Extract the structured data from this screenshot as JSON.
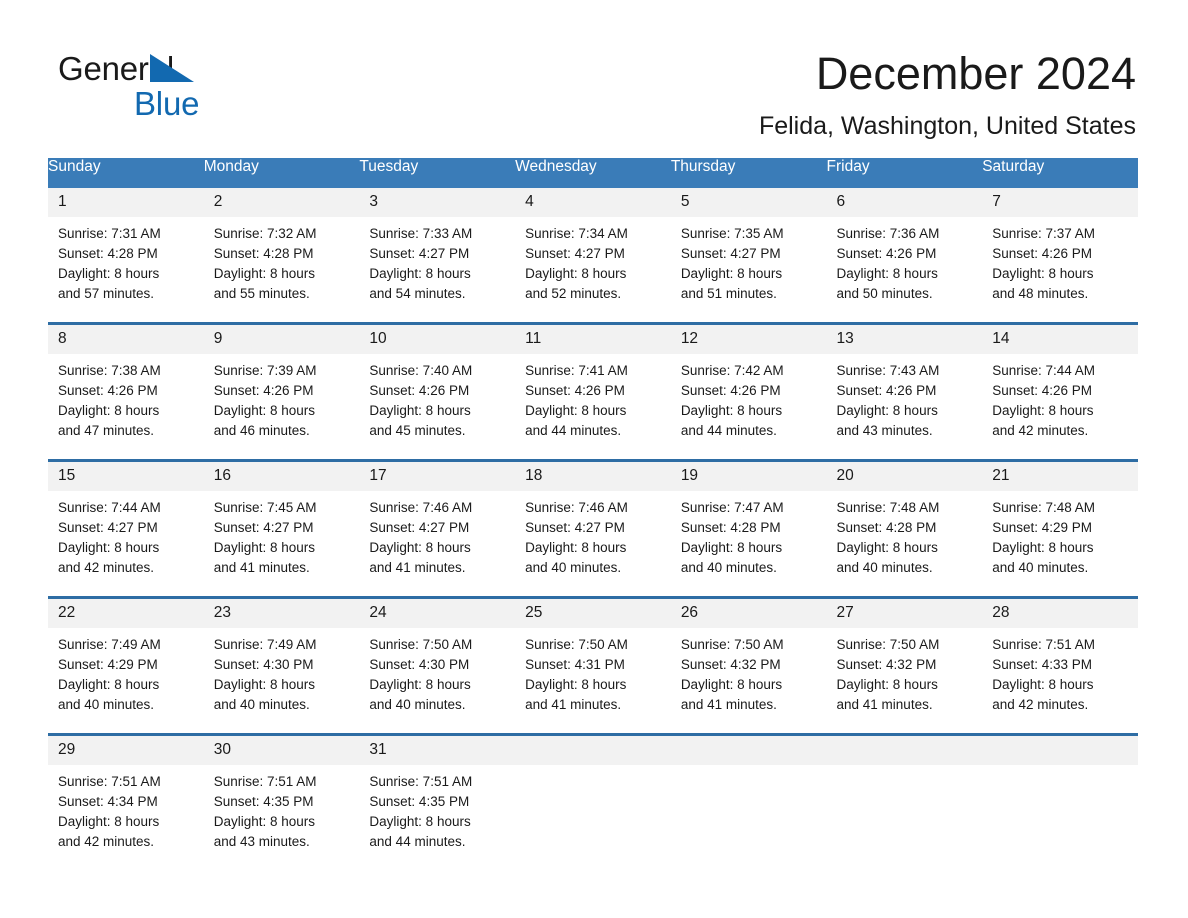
{
  "brand": {
    "name_line1": "General",
    "name_line2": "Blue",
    "accent_color": "#1269b0"
  },
  "header": {
    "month_title": "December 2024",
    "location": "Felida, Washington, United States"
  },
  "theme": {
    "header_blue": "#3a7cb8",
    "row_divider_blue": "#2e6da4",
    "daynum_band": "#f2f2f2",
    "text": "#1a1a1a"
  },
  "weekday_headers": [
    "Sunday",
    "Monday",
    "Tuesday",
    "Wednesday",
    "Thursday",
    "Friday",
    "Saturday"
  ],
  "weeks": [
    {
      "days": [
        {
          "day": "1",
          "sunrise": "Sunrise: 7:31 AM",
          "sunset": "Sunset: 4:28 PM",
          "daylight1": "Daylight: 8 hours",
          "daylight2": "and 57 minutes."
        },
        {
          "day": "2",
          "sunrise": "Sunrise: 7:32 AM",
          "sunset": "Sunset: 4:28 PM",
          "daylight1": "Daylight: 8 hours",
          "daylight2": "and 55 minutes."
        },
        {
          "day": "3",
          "sunrise": "Sunrise: 7:33 AM",
          "sunset": "Sunset: 4:27 PM",
          "daylight1": "Daylight: 8 hours",
          "daylight2": "and 54 minutes."
        },
        {
          "day": "4",
          "sunrise": "Sunrise: 7:34 AM",
          "sunset": "Sunset: 4:27 PM",
          "daylight1": "Daylight: 8 hours",
          "daylight2": "and 52 minutes."
        },
        {
          "day": "5",
          "sunrise": "Sunrise: 7:35 AM",
          "sunset": "Sunset: 4:27 PM",
          "daylight1": "Daylight: 8 hours",
          "daylight2": "and 51 minutes."
        },
        {
          "day": "6",
          "sunrise": "Sunrise: 7:36 AM",
          "sunset": "Sunset: 4:26 PM",
          "daylight1": "Daylight: 8 hours",
          "daylight2": "and 50 minutes."
        },
        {
          "day": "7",
          "sunrise": "Sunrise: 7:37 AM",
          "sunset": "Sunset: 4:26 PM",
          "daylight1": "Daylight: 8 hours",
          "daylight2": "and 48 minutes."
        }
      ]
    },
    {
      "days": [
        {
          "day": "8",
          "sunrise": "Sunrise: 7:38 AM",
          "sunset": "Sunset: 4:26 PM",
          "daylight1": "Daylight: 8 hours",
          "daylight2": "and 47 minutes."
        },
        {
          "day": "9",
          "sunrise": "Sunrise: 7:39 AM",
          "sunset": "Sunset: 4:26 PM",
          "daylight1": "Daylight: 8 hours",
          "daylight2": "and 46 minutes."
        },
        {
          "day": "10",
          "sunrise": "Sunrise: 7:40 AM",
          "sunset": "Sunset: 4:26 PM",
          "daylight1": "Daylight: 8 hours",
          "daylight2": "and 45 minutes."
        },
        {
          "day": "11",
          "sunrise": "Sunrise: 7:41 AM",
          "sunset": "Sunset: 4:26 PM",
          "daylight1": "Daylight: 8 hours",
          "daylight2": "and 44 minutes."
        },
        {
          "day": "12",
          "sunrise": "Sunrise: 7:42 AM",
          "sunset": "Sunset: 4:26 PM",
          "daylight1": "Daylight: 8 hours",
          "daylight2": "and 44 minutes."
        },
        {
          "day": "13",
          "sunrise": "Sunrise: 7:43 AM",
          "sunset": "Sunset: 4:26 PM",
          "daylight1": "Daylight: 8 hours",
          "daylight2": "and 43 minutes."
        },
        {
          "day": "14",
          "sunrise": "Sunrise: 7:44 AM",
          "sunset": "Sunset: 4:26 PM",
          "daylight1": "Daylight: 8 hours",
          "daylight2": "and 42 minutes."
        }
      ]
    },
    {
      "days": [
        {
          "day": "15",
          "sunrise": "Sunrise: 7:44 AM",
          "sunset": "Sunset: 4:27 PM",
          "daylight1": "Daylight: 8 hours",
          "daylight2": "and 42 minutes."
        },
        {
          "day": "16",
          "sunrise": "Sunrise: 7:45 AM",
          "sunset": "Sunset: 4:27 PM",
          "daylight1": "Daylight: 8 hours",
          "daylight2": "and 41 minutes."
        },
        {
          "day": "17",
          "sunrise": "Sunrise: 7:46 AM",
          "sunset": "Sunset: 4:27 PM",
          "daylight1": "Daylight: 8 hours",
          "daylight2": "and 41 minutes."
        },
        {
          "day": "18",
          "sunrise": "Sunrise: 7:46 AM",
          "sunset": "Sunset: 4:27 PM",
          "daylight1": "Daylight: 8 hours",
          "daylight2": "and 40 minutes."
        },
        {
          "day": "19",
          "sunrise": "Sunrise: 7:47 AM",
          "sunset": "Sunset: 4:28 PM",
          "daylight1": "Daylight: 8 hours",
          "daylight2": "and 40 minutes."
        },
        {
          "day": "20",
          "sunrise": "Sunrise: 7:48 AM",
          "sunset": "Sunset: 4:28 PM",
          "daylight1": "Daylight: 8 hours",
          "daylight2": "and 40 minutes."
        },
        {
          "day": "21",
          "sunrise": "Sunrise: 7:48 AM",
          "sunset": "Sunset: 4:29 PM",
          "daylight1": "Daylight: 8 hours",
          "daylight2": "and 40 minutes."
        }
      ]
    },
    {
      "days": [
        {
          "day": "22",
          "sunrise": "Sunrise: 7:49 AM",
          "sunset": "Sunset: 4:29 PM",
          "daylight1": "Daylight: 8 hours",
          "daylight2": "and 40 minutes."
        },
        {
          "day": "23",
          "sunrise": "Sunrise: 7:49 AM",
          "sunset": "Sunset: 4:30 PM",
          "daylight1": "Daylight: 8 hours",
          "daylight2": "and 40 minutes."
        },
        {
          "day": "24",
          "sunrise": "Sunrise: 7:50 AM",
          "sunset": "Sunset: 4:30 PM",
          "daylight1": "Daylight: 8 hours",
          "daylight2": "and 40 minutes."
        },
        {
          "day": "25",
          "sunrise": "Sunrise: 7:50 AM",
          "sunset": "Sunset: 4:31 PM",
          "daylight1": "Daylight: 8 hours",
          "daylight2": "and 41 minutes."
        },
        {
          "day": "26",
          "sunrise": "Sunrise: 7:50 AM",
          "sunset": "Sunset: 4:32 PM",
          "daylight1": "Daylight: 8 hours",
          "daylight2": "and 41 minutes."
        },
        {
          "day": "27",
          "sunrise": "Sunrise: 7:50 AM",
          "sunset": "Sunset: 4:32 PM",
          "daylight1": "Daylight: 8 hours",
          "daylight2": "and 41 minutes."
        },
        {
          "day": "28",
          "sunrise": "Sunrise: 7:51 AM",
          "sunset": "Sunset: 4:33 PM",
          "daylight1": "Daylight: 8 hours",
          "daylight2": "and 42 minutes."
        }
      ]
    },
    {
      "days": [
        {
          "day": "29",
          "sunrise": "Sunrise: 7:51 AM",
          "sunset": "Sunset: 4:34 PM",
          "daylight1": "Daylight: 8 hours",
          "daylight2": "and 42 minutes."
        },
        {
          "day": "30",
          "sunrise": "Sunrise: 7:51 AM",
          "sunset": "Sunset: 4:35 PM",
          "daylight1": "Daylight: 8 hours",
          "daylight2": "and 43 minutes."
        },
        {
          "day": "31",
          "sunrise": "Sunrise: 7:51 AM",
          "sunset": "Sunset: 4:35 PM",
          "daylight1": "Daylight: 8 hours",
          "daylight2": "and 44 minutes."
        },
        {
          "day": "",
          "sunrise": "",
          "sunset": "",
          "daylight1": "",
          "daylight2": ""
        },
        {
          "day": "",
          "sunrise": "",
          "sunset": "",
          "daylight1": "",
          "daylight2": ""
        },
        {
          "day": "",
          "sunrise": "",
          "sunset": "",
          "daylight1": "",
          "daylight2": ""
        },
        {
          "day": "",
          "sunrise": "",
          "sunset": "",
          "daylight1": "",
          "daylight2": ""
        }
      ]
    }
  ]
}
